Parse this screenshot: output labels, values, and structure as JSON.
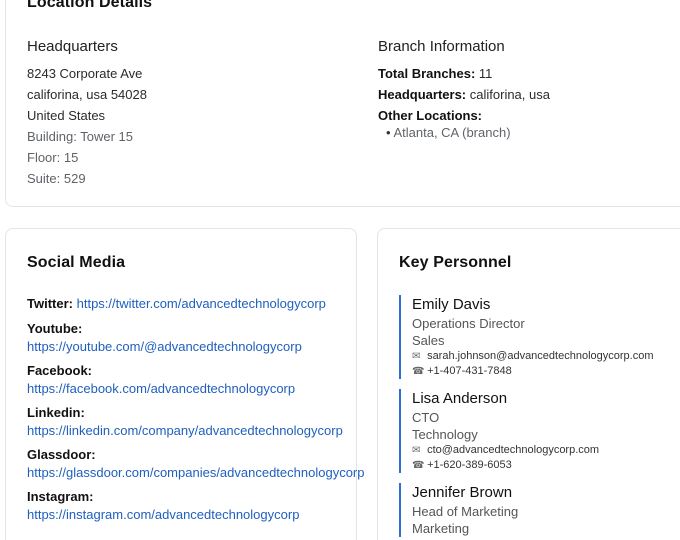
{
  "location": {
    "title": "Location Details",
    "hq": {
      "heading": "Headquarters",
      "address1": "8243 Corporate Ave",
      "address2": "califorina, usa 54028",
      "country": "United States",
      "building": "Building: Tower 15",
      "floor": "Floor: 15",
      "suite": "Suite: 529"
    },
    "branch": {
      "heading": "Branch Information",
      "total_label": "Total Branches:",
      "total_value": "11",
      "hq_label": "Headquarters:",
      "hq_value": "califorina, usa",
      "other_label": "Other Locations:",
      "other_items": [
        "Atlanta, CA (branch)"
      ]
    }
  },
  "social": {
    "title": "Social Media",
    "items": [
      {
        "label": "Twitter:",
        "url": "https://twitter.com/advancedtechnologycorp"
      },
      {
        "label": "Youtube:",
        "url": "https://youtube.com/@advancedtechnologycorp"
      },
      {
        "label": "Facebook:",
        "url": "https://facebook.com/advancedtechnologycorp"
      },
      {
        "label": "Linkedin:",
        "url": "https://linkedin.com/company/advancedtechnologycorp"
      },
      {
        "label": "Glassdoor:",
        "url": "https://glassdoor.com/companies/advancedtechnologycorp"
      },
      {
        "label": "Instagram:",
        "url": "https://instagram.com/advancedtechnologycorp"
      }
    ]
  },
  "personnel": {
    "title": "Key Personnel",
    "people": [
      {
        "name": "Emily Davis",
        "title": "Operations Director",
        "dept": "Sales",
        "email": "sarah.johnson@advancedtechnologycorp.com",
        "phone": "+1-407-431-7848"
      },
      {
        "name": "Lisa Anderson",
        "title": "CTO",
        "dept": "Technology",
        "email": "cto@advancedtechnologycorp.com",
        "phone": "+1-620-389-6053"
      },
      {
        "name": "Jennifer Brown",
        "title": "Head of Marketing",
        "dept": "Marketing",
        "email": "",
        "phone": ""
      }
    ]
  },
  "icons": {
    "email": "email-icon",
    "phone": "phone-icon",
    "bullet": "bullet-icon"
  }
}
